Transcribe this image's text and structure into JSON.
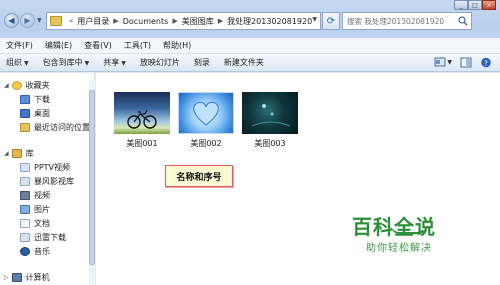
{
  "address": {
    "segments": [
      "用户目录",
      "Documents",
      "美图图库",
      "我处理201302081920"
    ]
  },
  "search": {
    "placeholder": "搜索 我处理201302081920"
  },
  "menubar": {
    "items": [
      "文件(F)",
      "编辑(E)",
      "查看(V)",
      "工具(T)",
      "帮助(H)"
    ]
  },
  "toolbar": {
    "organize": "组织",
    "include_in_library": "包含到库中",
    "share": "共享",
    "slideshow": "放映幻灯片",
    "burn": "刻录",
    "new_folder": "新建文件夹"
  },
  "sidebar": {
    "favorites": "收藏夹",
    "downloads": "下载",
    "desktop": "桌面",
    "recent": "最近访问的位置",
    "libraries": "库",
    "pptv": "PPTV视频",
    "baofeng": "暴风影视库",
    "videos": "视频",
    "pictures": "图片",
    "documents": "文档",
    "xunlei": "迅雷下载",
    "music": "音乐",
    "computer": "计算机"
  },
  "files": [
    {
      "name": "美图001"
    },
    {
      "name": "美图002"
    },
    {
      "name": "美图003"
    }
  ],
  "callout": {
    "text": "名称和序号"
  },
  "watermark": {
    "title": "百科全说",
    "subtitle": "助你轻松解决"
  },
  "colors": {
    "accent": "#2a8f37",
    "callout_border": "#e36060",
    "callout_bg": "#fefbd4"
  }
}
